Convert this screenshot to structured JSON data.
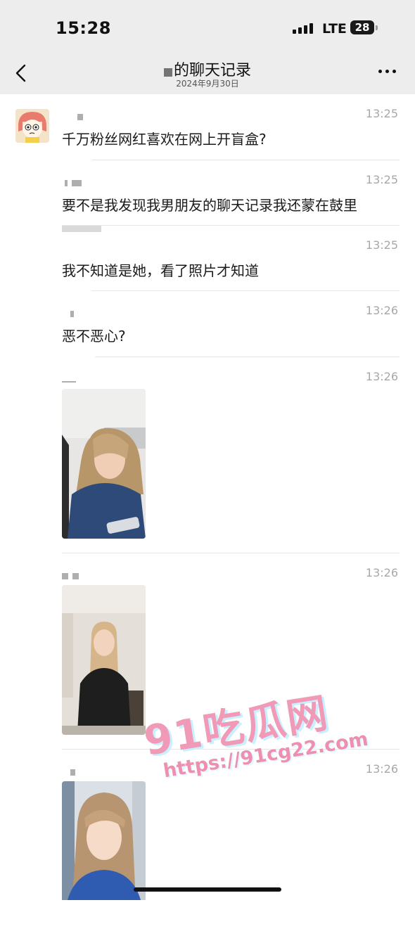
{
  "status_bar": {
    "time": "15:28",
    "network": "LTE",
    "battery": "28"
  },
  "nav": {
    "title": "的聊天记录",
    "date": "2024年9月30日"
  },
  "messages": [
    {
      "time": "13:25",
      "text": "千万粉丝网红喜欢在网上开盲盒?"
    },
    {
      "time": "13:25",
      "text": "要不是我发现我男朋友的聊天记录我还蒙在鼓里"
    },
    {
      "time": "13:25",
      "text": "我不知道是她，看了照片才知道"
    },
    {
      "time": "13:26",
      "text": "恶不恶心?"
    },
    {
      "time": "13:26",
      "photo": "photo-woman-denim-jacket"
    },
    {
      "time": "13:26",
      "photo": "photo-woman-black-jacket"
    },
    {
      "time": "13:26",
      "photo": "photo-woman-blue-shirt"
    }
  ],
  "watermark": {
    "main": "91吃瓜网",
    "url": "https://91cg22.com"
  },
  "colors": {
    "header_bg": "#ededed",
    "time_gray": "#a8a8a8",
    "divider": "#e6e6e6"
  }
}
